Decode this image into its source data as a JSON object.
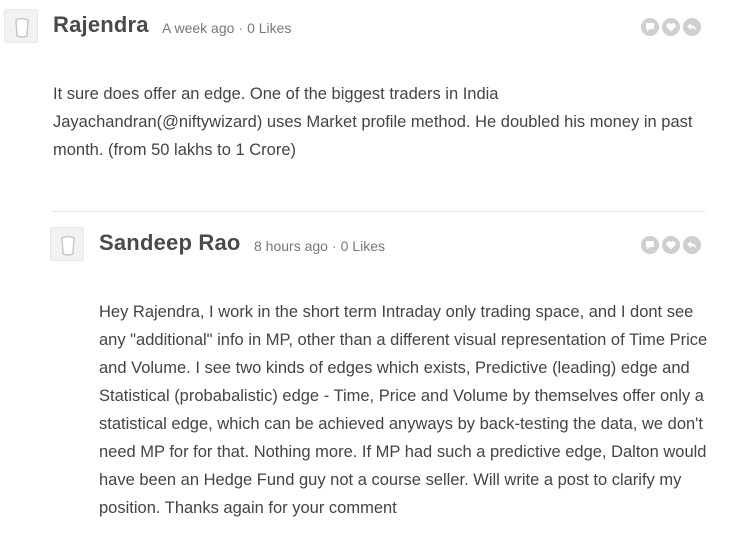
{
  "comments": [
    {
      "author": "Rajendra",
      "time": "A week ago",
      "likes": "0 Likes",
      "text": "It sure does offer an edge. One of the biggest traders in India Jayachandran(@niftywizard) uses Market profile method. He doubled his money in past month. (from 50 lakhs to 1 Crore)"
    },
    {
      "author": "Sandeep Rao",
      "time": "8 hours ago",
      "likes": "0 Likes",
      "text": "Hey Rajendra, I work in the short term Intraday only trading space, and I dont see any \"additional\" info in MP, other than a different visual representation of Time Price and Volume. I see two kinds of edges which exists, Predictive (leading) edge and Statistical (probabalistic) edge - Time, Price and Volume by themselves offer only a statistical edge, which can be achieved anyways by back-testing the data, we don't need MP for for that. Nothing more. If MP had such a predictive edge, Dalton would have been an Hedge Fund guy not a course seller. Will write a post to clarify my position. Thanks again for your comment"
    }
  ],
  "meta_separator": "·",
  "icons": [
    "avatar-placeholder-icon",
    "reply-icon",
    "like-icon",
    "share-icon"
  ],
  "colors": {
    "icon_bg": "#cfcfcf",
    "divider": "#e5e5e5",
    "author": "#4a4a4a",
    "meta": "#777777"
  }
}
